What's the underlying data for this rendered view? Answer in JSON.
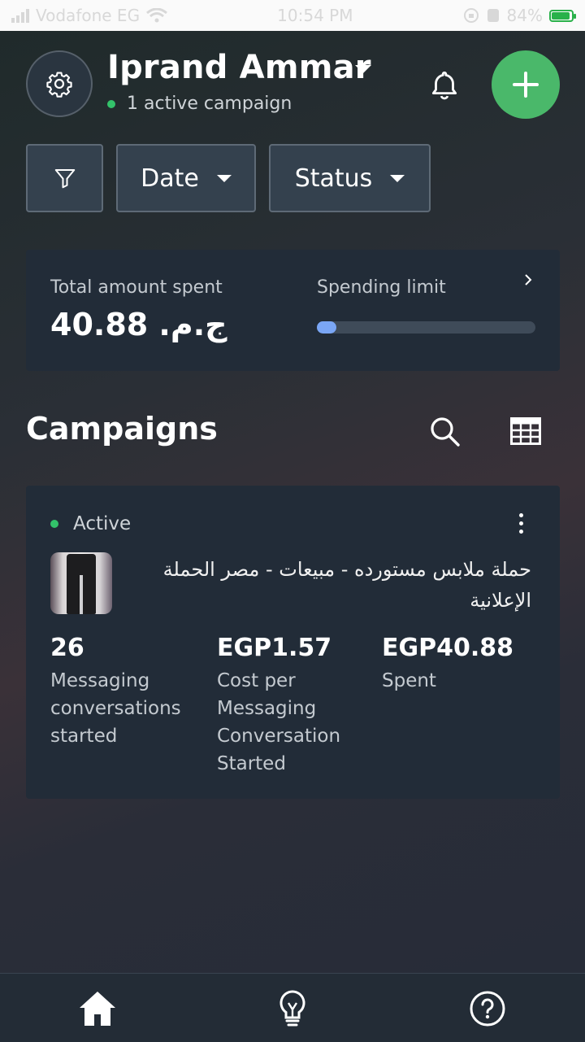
{
  "status_bar": {
    "carrier": "Vodafone EG",
    "time": "10:54 PM",
    "battery": "84%"
  },
  "header": {
    "account_name": "Iprand Ammar",
    "active_campaigns": "1 active campaign"
  },
  "filters": {
    "date_label": "Date",
    "status_label": "Status"
  },
  "summary": {
    "total_label": "Total amount spent",
    "total_value": "ج.م. 40.88",
    "limit_label": "Spending limit",
    "limit_progress": 0.09
  },
  "campaigns": {
    "title": "Campaigns",
    "items": [
      {
        "status": "Active",
        "name": "حملة ملابس مستورده - مبيعات - مصر  الحملة الإعلانية",
        "metrics": [
          {
            "value": "26",
            "label": "Messaging conversations started"
          },
          {
            "value": "EGP1.57",
            "label": "Cost per Messaging Conversation Started"
          },
          {
            "value": "EGP40.88",
            "label": "Spent"
          }
        ]
      }
    ]
  },
  "colors": {
    "accent_green": "#4ab86a",
    "active_dot": "#33c26a",
    "progress": "#7aa6f5",
    "card_bg": "#222c38"
  },
  "icons": [
    "gear-icon",
    "chevron-down-icon",
    "bell-icon",
    "plus-icon",
    "filter-icon",
    "chevron-right-icon",
    "search-icon",
    "table-icon",
    "more-vertical-icon",
    "home-icon",
    "lightbulb-icon",
    "help-icon"
  ]
}
